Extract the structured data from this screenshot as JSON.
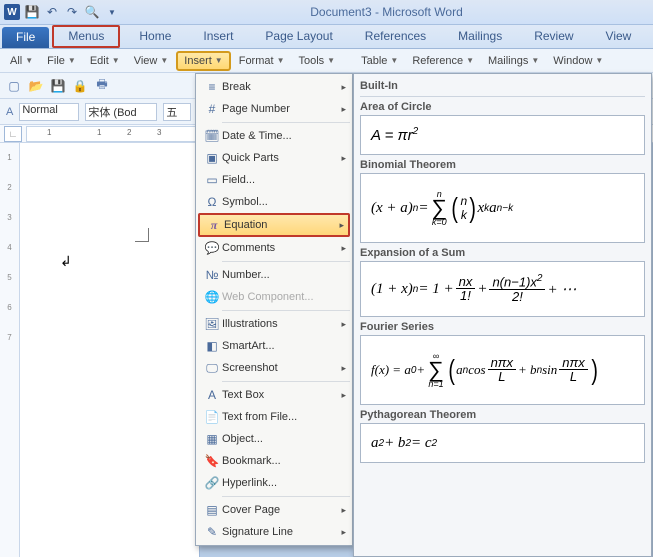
{
  "titlebar": {
    "title": "Document3 - Microsoft Word",
    "app_icon": "W"
  },
  "tabs": {
    "file": "File",
    "menus": "Menus",
    "home": "Home",
    "insert": "Insert",
    "page_layout": "Page Layout",
    "references": "References",
    "mailings": "Mailings",
    "review": "Review",
    "view": "View"
  },
  "secondary": {
    "all": "All",
    "file": "File",
    "edit": "Edit",
    "view": "View",
    "insert": "Insert",
    "format": "Format",
    "tools": "Tools",
    "table": "Table",
    "reference": "Reference",
    "mailings": "Mailings",
    "window": "Window"
  },
  "style_row": {
    "style": "Normal",
    "font": "宋体 (Bod",
    "size": "五"
  },
  "ruler": {
    "marks": [
      "1",
      "",
      "1",
      "2",
      "3"
    ]
  },
  "vruler": {
    "marks": [
      "1",
      "2",
      "3",
      "4",
      "5",
      "6",
      "7"
    ]
  },
  "menu": {
    "break": "Break",
    "page_number": "Page Number",
    "date_time": "Date & Time...",
    "quick_parts": "Quick Parts",
    "field": "Field...",
    "symbol": "Symbol...",
    "equation": "Equation",
    "comments": "Comments",
    "number": "Number...",
    "web_component": "Web Component...",
    "illustrations": "Illustrations",
    "smartart": "SmartArt...",
    "screenshot": "Screenshot",
    "text_box": "Text Box",
    "text_from_file": "Text from File...",
    "object": "Object...",
    "bookmark": "Bookmark...",
    "hyperlink": "Hyperlink...",
    "cover_page": "Cover Page",
    "signature_line": "Signature Line"
  },
  "gallery": {
    "header": "Built-In",
    "items": [
      {
        "label": "Area of Circle"
      },
      {
        "label": "Binomial Theorem"
      },
      {
        "label": "Expansion of a Sum"
      },
      {
        "label": "Fourier Series"
      },
      {
        "label": "Pythagorean Theorem"
      }
    ]
  },
  "chart_data": {
    "type": "table",
    "title": "Built-In Equations",
    "rows": [
      {
        "name": "Area of Circle",
        "formula": "A = π r^2"
      },
      {
        "name": "Binomial Theorem",
        "formula": "(x + a)^n = Σ_{k=0}^{n} C(n,k) x^k a^{n-k}"
      },
      {
        "name": "Expansion of a Sum",
        "formula": "(1 + x)^n = 1 + n x / 1! + n(n-1) x^2 / 2! + …"
      },
      {
        "name": "Fourier Series",
        "formula": "f(x) = a_0 + Σ_{n=1}^{∞} ( a_n cos(nπx/L) + b_n sin(nπx/L) )"
      },
      {
        "name": "Pythagorean Theorem",
        "formula": "a^2 + b^2 = c^2"
      }
    ]
  }
}
